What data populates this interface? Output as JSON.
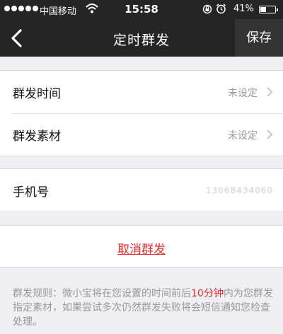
{
  "status_bar": {
    "carrier": "中国移动",
    "time": "15:58",
    "battery_percent": "41%",
    "battery_level": 0.41,
    "icons": [
      "signal-dots-icon",
      "wifi-icon",
      "rotation-lock-icon",
      "alarm-icon",
      "battery-icon"
    ]
  },
  "nav": {
    "back_icon": "chevron-left-icon",
    "title": "定时群发",
    "save_label": "保存"
  },
  "settings": {
    "send_time": {
      "label": "群发时间",
      "value": "未设定"
    },
    "send_material": {
      "label": "群发素材",
      "value": "未设定"
    }
  },
  "phone": {
    "label": "手机号",
    "value": "13068434060"
  },
  "actions": {
    "cancel_label": "取消群发"
  },
  "rules": {
    "prefix": "群发规则：微小宝将在您设置的时间前后",
    "highlight": "10分钟",
    "suffix": "内为您群发指定素材，如果尝试多次仍然群发失败将会短信通知您检查处理。"
  },
  "colors": {
    "bar_background": "#252525",
    "accent_red": "#e3312f",
    "page_background": "#efeff4"
  }
}
